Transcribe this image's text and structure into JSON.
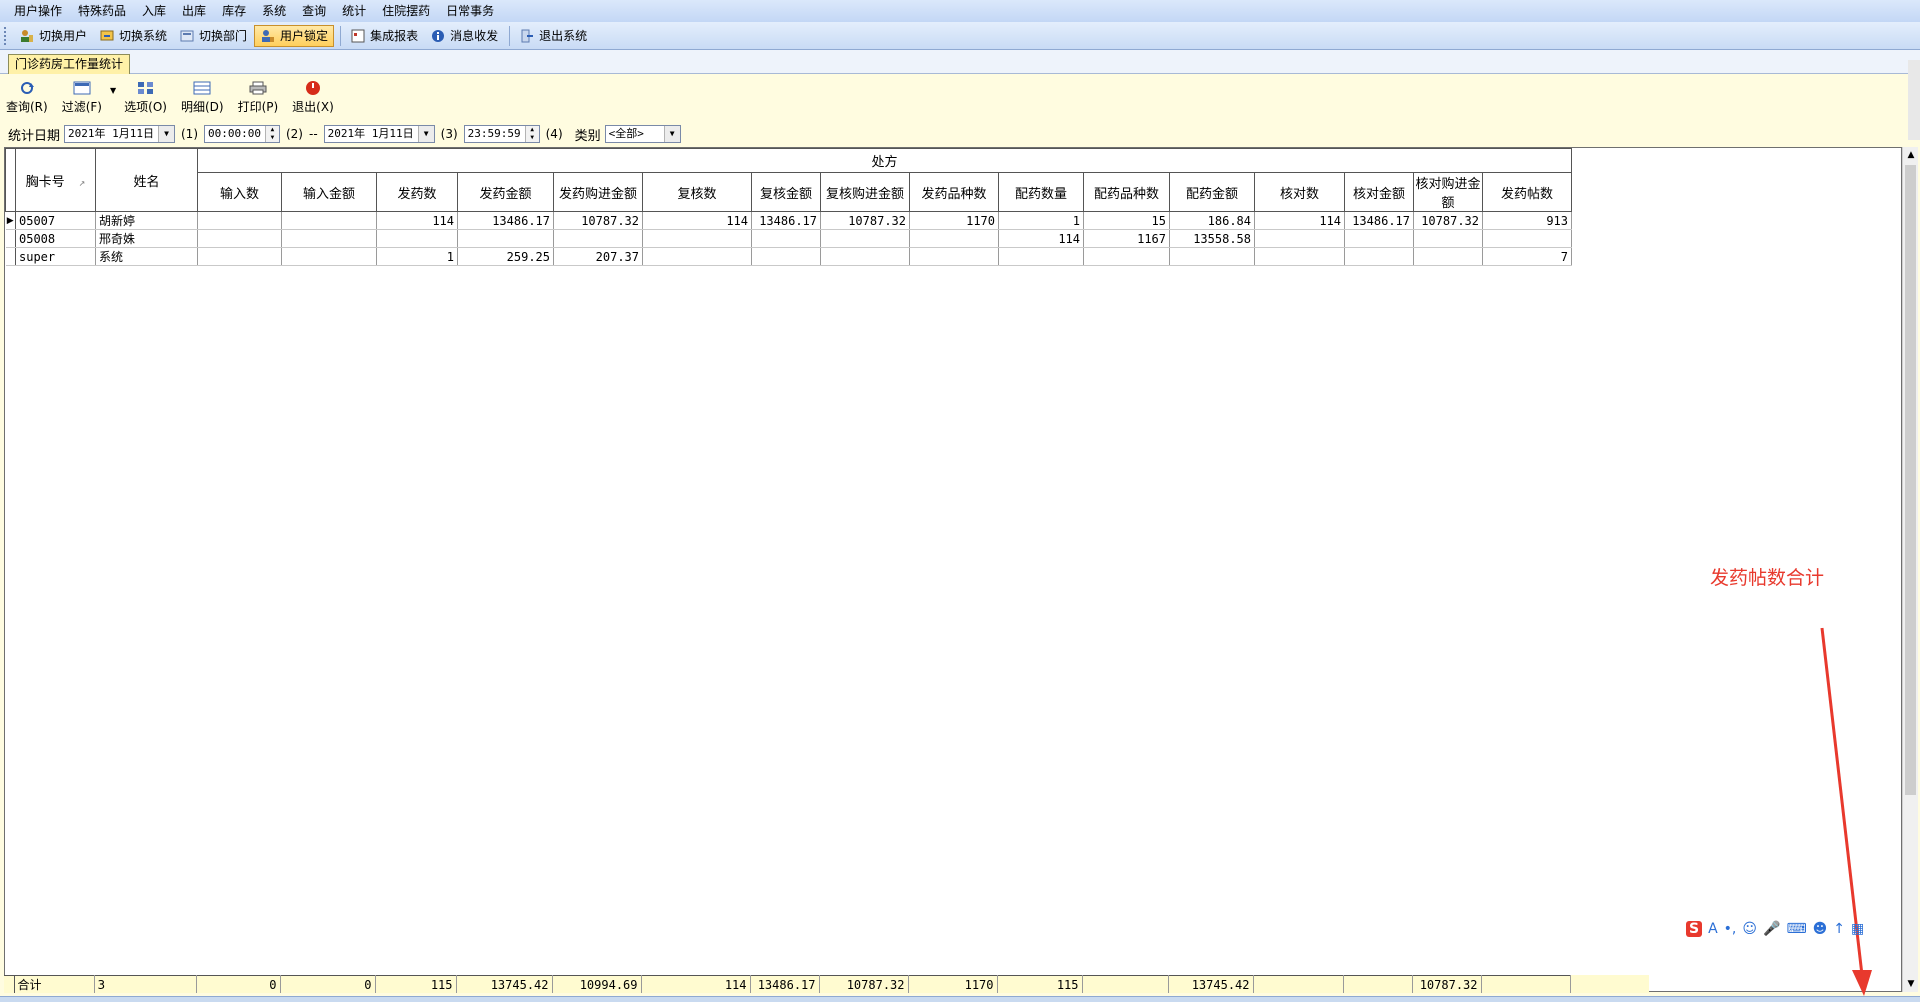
{
  "menu": [
    "用户操作",
    "特殊药品",
    "入库",
    "出库",
    "库存",
    "系统",
    "查询",
    "统计",
    "住院摆药",
    "日常事务"
  ],
  "toolbar": [
    {
      "label": "切换用户",
      "icon": "switch-user-icon"
    },
    {
      "label": "切换系统",
      "icon": "switch-system-icon"
    },
    {
      "label": "切换部门",
      "icon": "switch-dept-icon"
    },
    {
      "label": "用户锁定",
      "icon": "lock-user-icon"
    },
    {
      "label": "集成报表",
      "icon": "report-icon"
    },
    {
      "label": "消息收发",
      "icon": "info-icon"
    },
    {
      "label": "退出系统",
      "icon": "exit-icon"
    }
  ],
  "tab": {
    "label": "门诊药房工作量统计"
  },
  "actions": [
    {
      "label": "查询(R)",
      "icon": "refresh-icon"
    },
    {
      "label": "过滤(F)",
      "icon": "filter-icon"
    },
    {
      "label": "选项(O)",
      "icon": "options-icon"
    },
    {
      "label": "明细(D)",
      "icon": "detail-icon"
    },
    {
      "label": "打印(P)",
      "icon": "print-icon"
    },
    {
      "label": "退出(X)",
      "icon": "power-icon"
    }
  ],
  "filter": {
    "label": "统计日期",
    "date_from": "2021年 1月11日",
    "marker1": "(1)",
    "time_from": "00:00:00",
    "marker2": "(2)",
    "dash": "--",
    "date_to": "2021年 1月11日",
    "marker3": "(3)",
    "time_to": "23:59:59",
    "marker4": "(4)",
    "category_label": "类别",
    "category_value": "<全部>"
  },
  "grid": {
    "group_header": "处方",
    "col_card": "胸卡号",
    "col_name": "姓名",
    "columns": [
      "输入数",
      "输入金额",
      "发药数",
      "发药金额",
      "发药购进金额",
      "复核数",
      "复核金额",
      "复核购进金额",
      "发药品种数",
      "配药数量",
      "配药品种数",
      "配药金额",
      "核对数",
      "核对金额",
      "核对购进金额",
      "发药帖数"
    ],
    "rows": [
      {
        "card": "05007",
        "name": "胡新婷",
        "values": [
          "",
          "",
          "114",
          "13486.17",
          "10787.32",
          "114",
          "13486.17",
          "10787.32",
          "1170",
          "1",
          "15",
          "186.84",
          "114",
          "13486.17",
          "10787.32",
          "913"
        ]
      },
      {
        "card": "05008",
        "name": "邢奇姝",
        "values": [
          "",
          "",
          "",
          "",
          "",
          "",
          "",
          "",
          "",
          "114",
          "1167",
          "13558.58",
          "",
          "",
          "",
          ""
        ]
      },
      {
        "card": "super",
        "name": "系统",
        "values": [
          "",
          "",
          "1",
          "259.25",
          "207.37",
          "",
          "",
          "",
          "",
          "",
          "",
          "",
          "",
          "",
          "",
          "7"
        ]
      }
    ],
    "total": {
      "label": "合计",
      "count": "3",
      "values": [
        "0",
        "0",
        "115",
        "13745.42",
        "10994.69",
        "114",
        "13486.17",
        "10787.32",
        "1170",
        "115",
        "",
        "13745.42",
        "",
        "",
        "10787.32",
        ""
      ]
    }
  },
  "annotation": "发药帖数合计",
  "colors": {
    "annotation": "#e8392d",
    "tab_bg": "#fff1a8",
    "panel_bg": "#fffce0"
  }
}
